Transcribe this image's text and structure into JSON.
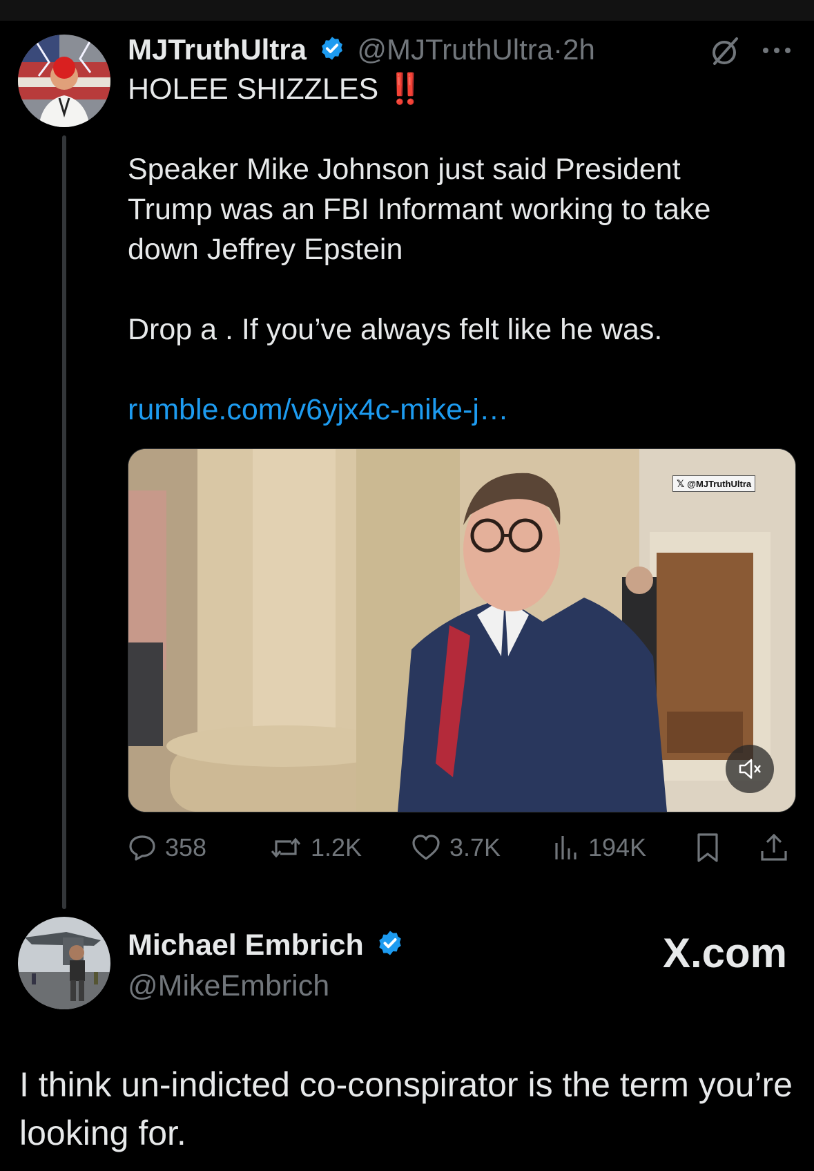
{
  "post": {
    "display_name": "MJTruthUltra",
    "handle": "@MJTruthUltra",
    "separator": "·",
    "time": "2h",
    "headline": "HOLEE SHIZZLES",
    "headline_emoji": "‼️",
    "paragraph1": "Speaker Mike Johnson just said President Trump was an FBI Informant working to take down Jeffrey Epstein",
    "paragraph2": "Drop a . If you’ve always felt like he was.",
    "link": "rumble.com/v6yjx4c-mike-j…",
    "video_watermark": "@MJTruthUltra",
    "stats": {
      "replies": "358",
      "reposts": "1.2K",
      "likes": "3.7K",
      "views": "194K"
    }
  },
  "reply": {
    "display_name": "Michael Embrich",
    "handle": "@MikeEmbrich",
    "text": "I think un-indicted co-conspirator is the term you’re looking for."
  },
  "brand": "X.com",
  "colors": {
    "background": "#000000",
    "text": "#e7e9ea",
    "muted": "#71767b",
    "link": "#1d9bf0",
    "verified": "#1d9bf0",
    "emoji_red": "#f91e1e"
  },
  "icons": [
    "verified-badge-icon",
    "grok-icon",
    "more-icon",
    "reply-icon",
    "repost-icon",
    "like-icon",
    "views-icon",
    "bookmark-icon",
    "share-icon",
    "mute-icon",
    "x-logo-icon"
  ]
}
